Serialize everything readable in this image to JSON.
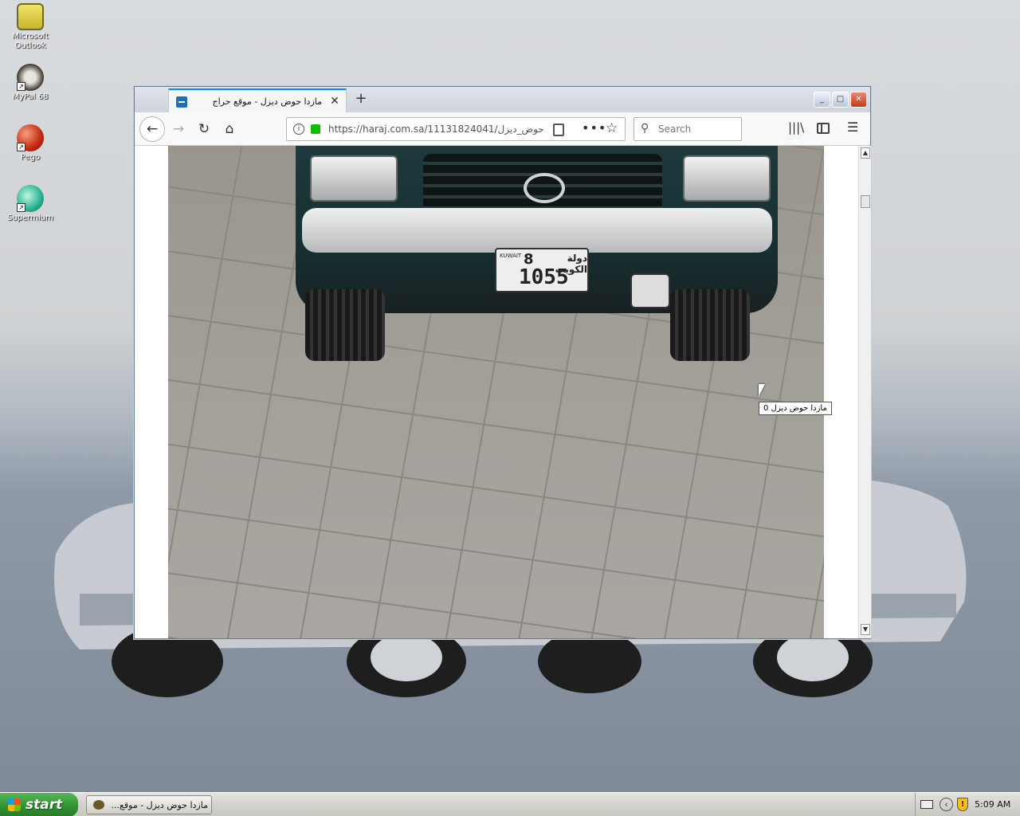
{
  "desktop": {
    "icons": [
      {
        "label": "Microsoft Outlook"
      },
      {
        "label": "MyPal 68"
      },
      {
        "label": "Pego"
      },
      {
        "label": "Supermium"
      }
    ]
  },
  "browser": {
    "tab": {
      "title": "مازدا حوض ديزل - موقع حراج"
    },
    "url": "https://haraj.com.sa/11131824041/مازدا_حوض_ديزل",
    "search_placeholder": "Search",
    "controls": {
      "minimize": "_",
      "maximize": "□",
      "close": "✕"
    }
  },
  "content": {
    "plate": {
      "digit": "8",
      "arabic": "دولة الكويت",
      "number": "1055",
      "side": "KUWAIT"
    },
    "tooltip": "مازدا حوض ديزل 0"
  },
  "taskbar": {
    "start_label": "start",
    "task_item": "مازدا حوض ديزل - موقع...",
    "clock": "5:09 AM"
  },
  "colors": {
    "accent": "#0a84ff",
    "start_green": "#3c9c3c",
    "lock_green": "#12bc00"
  }
}
